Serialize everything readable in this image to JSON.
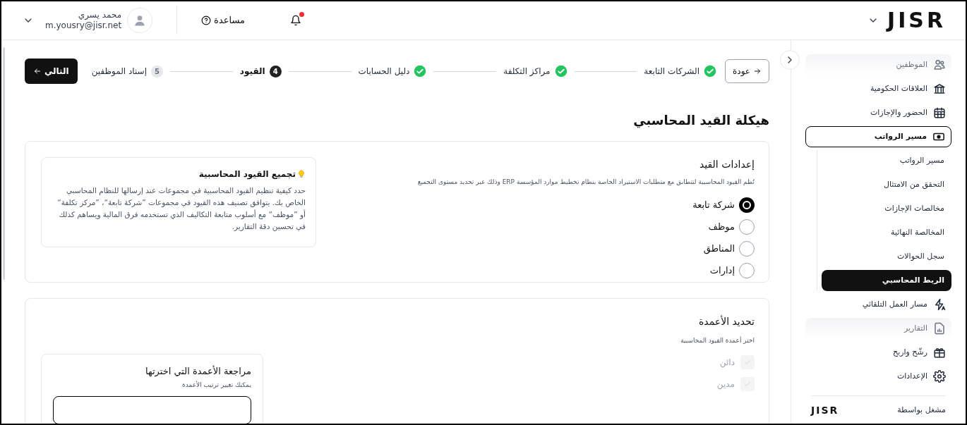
{
  "header": {
    "logo": "JISR",
    "notifications_unread": true,
    "help": "مساعدة",
    "user": {
      "name": "محمد يسري",
      "email": "m.yousry@jisr.net"
    }
  },
  "sidebar": {
    "items": [
      {
        "label": "الموظفين",
        "disabled": true,
        "selected": false
      },
      {
        "label": "العلاقات الحكومية",
        "disabled": false,
        "selected": false
      },
      {
        "label": "الحضور والإجازات",
        "disabled": false,
        "selected": false
      },
      {
        "label": "مسير الرواتب",
        "disabled": false,
        "selected": false,
        "expanded": true,
        "children": [
          {
            "label": "مسير الرواتب",
            "selected": false
          },
          {
            "label": "التحقق من الامتثال",
            "selected": false
          },
          {
            "label": "مخالصات الإجازات",
            "selected": false
          },
          {
            "label": "المخالصة النهائية",
            "selected": false
          },
          {
            "label": "سجل الحوالات",
            "selected": false
          },
          {
            "label": "الربط المحاسبي",
            "selected": true
          }
        ]
      },
      {
        "label": "مسار العمل التلقائي",
        "disabled": false,
        "selected": false
      },
      {
        "label": "التقارير",
        "disabled": true,
        "selected": false
      },
      {
        "label": "رشّح واربح",
        "disabled": false,
        "selected": false
      },
      {
        "label": "الإعدادات",
        "disabled": false,
        "selected": false
      }
    ],
    "footer": {
      "label": "مشغل بواسطة",
      "logo": "JISR"
    }
  },
  "stepper": {
    "back": "عودة",
    "next": "التالي",
    "steps": [
      {
        "label": "الشركات التابعة",
        "completed": true,
        "current": false
      },
      {
        "label": "مراكز التكلفة",
        "completed": true,
        "current": false
      },
      {
        "label": "دليل الحسابات",
        "completed": true,
        "current": false
      },
      {
        "number": "4",
        "label": "القيود",
        "completed": false,
        "current": true
      },
      {
        "number": "5",
        "label": "إسناد الموظفين",
        "completed": false,
        "current": false
      }
    ]
  },
  "page_title": "هيكلة القيد المحاسبي",
  "entry_settings": {
    "title": "إعدادات القيد",
    "description": "نُظم القيود المحاسبية لتتطابق مع متطلبات الاستيراد الخاصة بنظام تخطيط موارد المؤسسة ERP وذلك عبر تحديد مستوى التجميع",
    "options": [
      {
        "label": "شركة تابعة",
        "selected": true
      },
      {
        "label": "موظف",
        "selected": false
      },
      {
        "label": "المناطق",
        "selected": false
      },
      {
        "label": "إدارات",
        "selected": false
      }
    ],
    "tip": {
      "title": "تجميع القيود المحاسبية",
      "text": "حدد كيفية تنظيم القيود المحاسبية في مجموعات عند إرسالها للنظام المحاسبي الخاص بك. يتوافق تصنيف هذه القيود في مجموعات ”شركة تابعة“، ”مركز تكلفة“ أو ”موظف“ مع أسلوب متابعة التكاليف الذي تستخدمه فرق المالية ويساهم كذلك في تحسين دقة التقارير."
    }
  },
  "columns": {
    "title": "تحديد الأعمدة",
    "subtitle": "اختر أعمدة القيود المحاسبية",
    "options": [
      {
        "label": "دائن",
        "checked": true,
        "disabled": true
      },
      {
        "label": "مدين",
        "checked": true,
        "disabled": true
      }
    ],
    "review": {
      "title": "مراجعة الأعمدة التي اخترتها",
      "subtitle": "يمكنك تغيير ترتيب الأعمدة"
    }
  }
}
